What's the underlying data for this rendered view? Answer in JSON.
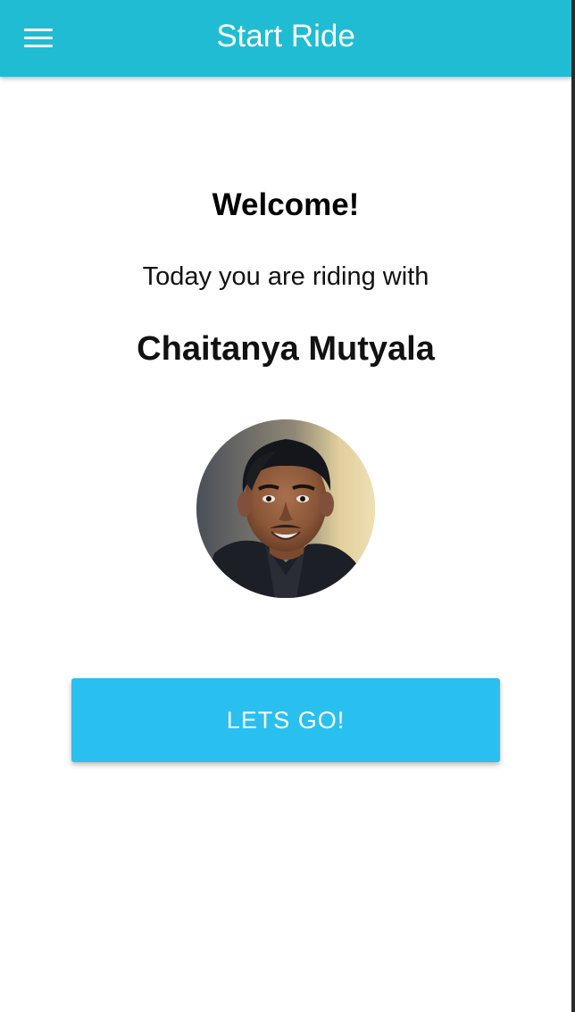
{
  "app_bar": {
    "title": "Start Ride",
    "menu_icon": "hamburger-menu-icon",
    "background_color": "#20bcd4"
  },
  "main": {
    "welcome": "Welcome!",
    "subtitle": "Today you are riding with",
    "rider_name": "Chaitanya Mutyala",
    "avatar": "rider-photo",
    "action_button": {
      "label": "LETS GO!",
      "color": "#29c0f0"
    }
  }
}
